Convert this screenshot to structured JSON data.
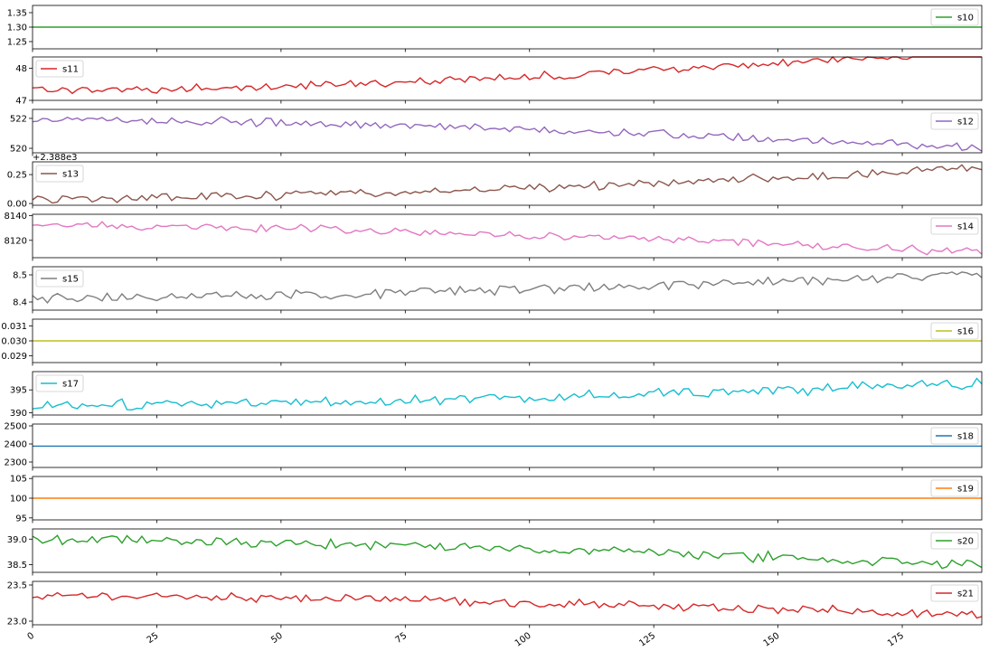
{
  "chart_data": {
    "type": "line",
    "x_ticks": [
      0,
      25,
      50,
      75,
      100,
      125,
      150,
      175
    ],
    "xlim": [
      0,
      191
    ],
    "panels": [
      {
        "name": "s10",
        "legend_loc": "right",
        "color": "#2ca02c",
        "ylim": [
          1.225,
          1.375
        ],
        "y_ticks": [
          1.25,
          1.3,
          1.35
        ],
        "y_tick_labels": [
          "1.25",
          "1.30",
          "1.35"
        ],
        "base": 1.3,
        "amp": 0,
        "trend": 0,
        "seed": 1,
        "offset_label": ""
      },
      {
        "name": "s11",
        "legend_loc": "left",
        "color": "#d62728",
        "ylim": [
          47.0,
          48.35
        ],
        "y_ticks": [
          47,
          48
        ],
        "y_tick_labels": [
          "47",
          "48"
        ],
        "base": 47.3,
        "amp": 0.1,
        "trend": 1.25,
        "seed": 2,
        "offset_label": ""
      },
      {
        "name": "s12",
        "legend_loc": "right",
        "color": "#9467bd",
        "ylim": [
          519.7,
          522.6
        ],
        "y_ticks": [
          520,
          522
        ],
        "y_tick_labels": [
          "520",
          "522"
        ],
        "base": 521.95,
        "amp": 0.22,
        "trend": -1.95,
        "seed": 3,
        "offset_label": ""
      },
      {
        "name": "s13",
        "legend_loc": "left",
        "color": "#8c564b",
        "ylim": [
          2387.985,
          2388.36
        ],
        "y_ticks": [
          2388.0,
          2388.25
        ],
        "y_tick_labels": [
          "0.00",
          "0.25"
        ],
        "base": 2388.04,
        "amp": 0.03,
        "trend": 0.27,
        "seed": 4,
        "offset_label": "+2.388e3"
      },
      {
        "name": "s14",
        "legend_loc": "right",
        "color": "#e377c2",
        "ylim": [
          8106,
          8141
        ],
        "y_ticks": [
          8120,
          8140
        ],
        "y_tick_labels": [
          "8120",
          "8140"
        ],
        "base": 8132,
        "amp": 2.5,
        "trend": -22,
        "seed": 5,
        "offset_label": ""
      },
      {
        "name": "s15",
        "legend_loc": "left",
        "color": "#7f7f7f",
        "ylim": [
          8.37,
          8.53
        ],
        "y_ticks": [
          8.4,
          8.5
        ],
        "y_tick_labels": [
          "8.4",
          "8.5"
        ],
        "base": 8.415,
        "amp": 0.015,
        "trend": 0.09,
        "seed": 6,
        "offset_label": ""
      },
      {
        "name": "s16",
        "legend_loc": "right",
        "color": "#bcbd22",
        "ylim": [
          0.02855,
          0.03145
        ],
        "y_ticks": [
          0.029,
          0.03,
          0.031
        ],
        "y_tick_labels": [
          "0.029",
          "0.030",
          "0.031"
        ],
        "base": 0.03,
        "amp": 0,
        "trend": 0,
        "seed": 7,
        "offset_label": ""
      },
      {
        "name": "s17",
        "legend_loc": "left",
        "color": "#17becf",
        "ylim": [
          389.5,
          399
        ],
        "y_ticks": [
          390,
          395
        ],
        "y_tick_labels": [
          "390",
          "395"
        ],
        "base": 391.6,
        "amp": 1.0,
        "trend": 5,
        "seed": 8,
        "offset_label": ""
      },
      {
        "name": "s18",
        "legend_loc": "right",
        "color": "#1f77b4",
        "ylim": [
          2270,
          2510
        ],
        "y_ticks": [
          2300,
          2400,
          2500
        ],
        "y_tick_labels": [
          "2300",
          "2400",
          "2500"
        ],
        "base": 2388,
        "amp": 0,
        "trend": 0,
        "seed": 9,
        "offset_label": ""
      },
      {
        "name": "s19",
        "legend_loc": "right",
        "color": "#ff7f0e",
        "ylim": [
          94.5,
          105.5
        ],
        "y_ticks": [
          95,
          100,
          105
        ],
        "y_tick_labels": [
          "95",
          "100",
          "105"
        ],
        "base": 100,
        "amp": 0,
        "trend": 0,
        "seed": 10,
        "offset_label": ""
      },
      {
        "name": "s20",
        "legend_loc": "right",
        "color": "#2ca02c",
        "ylim": [
          38.35,
          39.2
        ],
        "y_ticks": [
          38.5,
          39.0
        ],
        "y_tick_labels": [
          "38.5",
          "39.0"
        ],
        "base": 38.98,
        "amp": 0.08,
        "trend": -0.5,
        "seed": 11,
        "offset_label": ""
      },
      {
        "name": "s21",
        "legend_loc": "right",
        "color": "#d62728",
        "ylim": [
          22.95,
          23.55
        ],
        "y_ticks": [
          23.0,
          23.5
        ],
        "y_tick_labels": [
          "23.0",
          "23.5"
        ],
        "base": 23.36,
        "amp": 0.05,
        "trend": -0.28,
        "seed": 12,
        "offset_label": ""
      }
    ]
  }
}
